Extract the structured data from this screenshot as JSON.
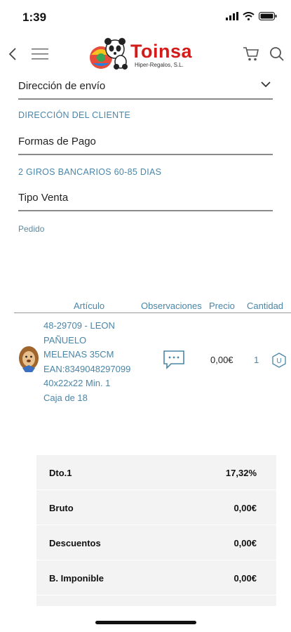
{
  "status_bar": {
    "time": "1:39"
  },
  "header": {
    "logo_title": "Toinsa",
    "logo_subtitle": "Hiper-Regalos, S.L.",
    "brand_color": "#d51a1a"
  },
  "form": {
    "shipping_label": "Dirección de envío",
    "shipping_value": "DIRECCIÓN DEL CLIENTE",
    "payment_label": "Formas de Pago",
    "payment_value": "2 GIROS BANCARIOS 60-85 DIAS",
    "sale_type_label": "Tipo Venta",
    "sale_type_value": "Pedido"
  },
  "table": {
    "headers": {
      "article": "Artículo",
      "observations": "Observaciones",
      "price": "Precio",
      "quantity": "Cantidad"
    },
    "rows": [
      {
        "lines": [
          "48-29709 - LEON",
          "PAÑUELO",
          "MELENAS 35CM",
          "EAN:8349048297099",
          "40x22x22 Min. 1",
          "Caja de 18"
        ],
        "price": "0,00€",
        "quantity": "1",
        "unit_badge": "U"
      }
    ]
  },
  "totals": [
    {
      "label": "Dto.1",
      "value": "17,32%"
    },
    {
      "label": "Bruto",
      "value": "0,00€"
    },
    {
      "label": "Descuentos",
      "value": "0,00€"
    },
    {
      "label": "B. Imponible",
      "value": "0,00€"
    }
  ],
  "icons": [
    "wifi-icon",
    "battery-icon",
    "back-arrow-icon",
    "hamburger-menu-icon",
    "panda-logo-icon",
    "cart-icon",
    "search-icon",
    "chevron-down-icon",
    "comment-icon",
    "unit-badge-icon"
  ],
  "colors": {
    "accent": "#4a86a8",
    "divider": "#8a8a8a",
    "totals_bg": "#f3f3f3"
  }
}
